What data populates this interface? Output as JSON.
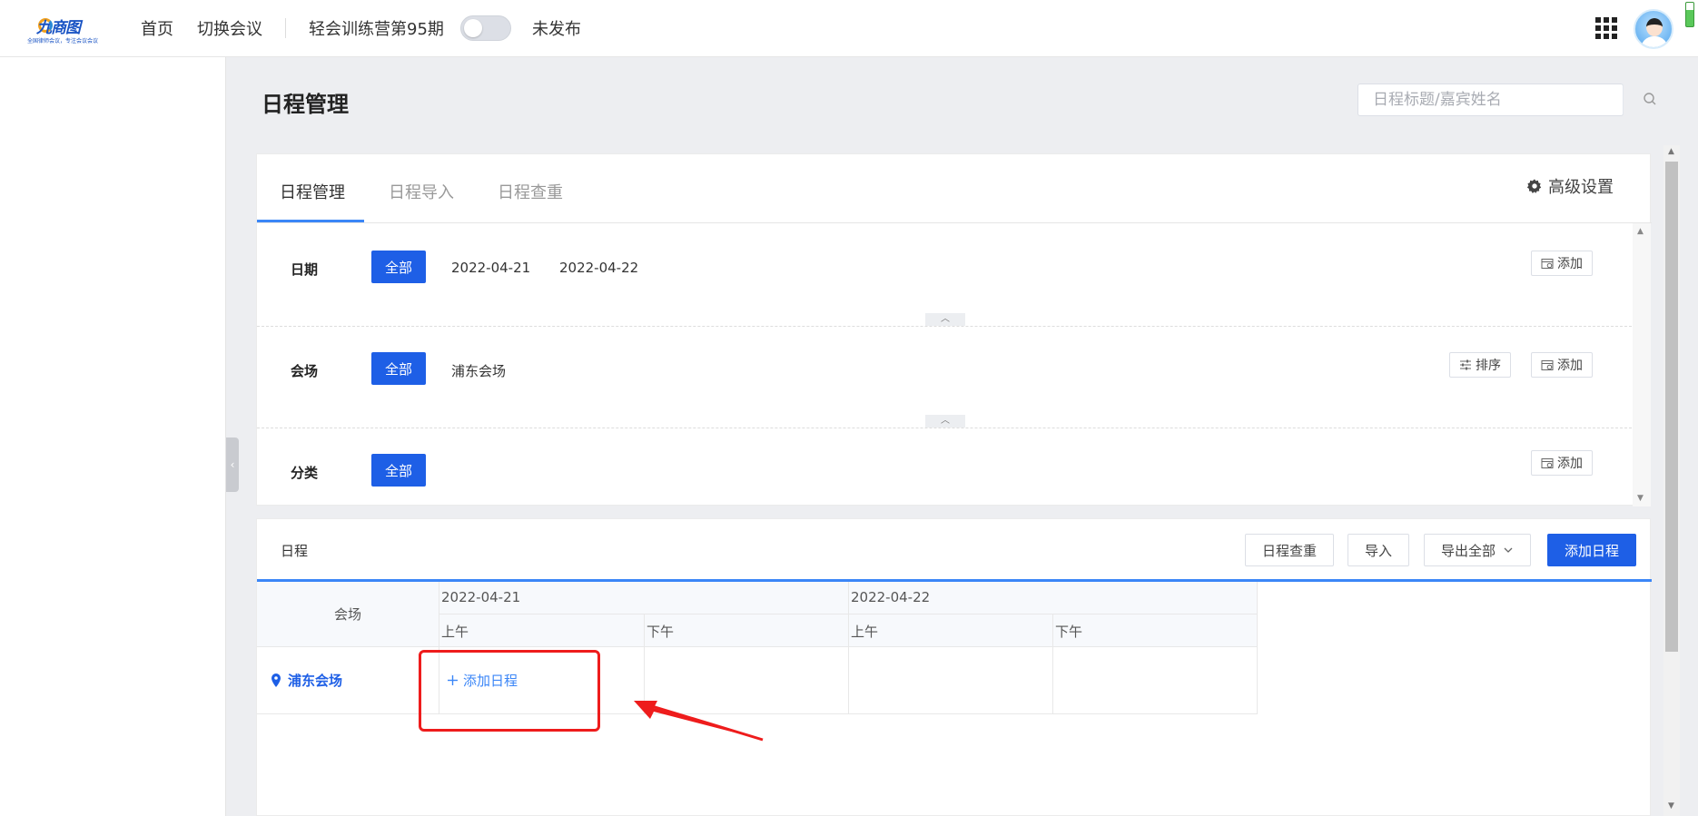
{
  "header": {
    "logo_text": "九商图",
    "logo_tagline": "全国律师会议，专注会议会议",
    "nav_home": "首页",
    "nav_switch": "切换会议",
    "meeting_title": "轻会训练营第95期",
    "publish_status": "未发布"
  },
  "page": {
    "title": "日程管理",
    "search_placeholder": "日程标题/嘉宾姓名"
  },
  "tabs": {
    "items": [
      "日程管理",
      "日程导入",
      "日程查重"
    ],
    "active": "日程管理",
    "advanced_settings": "高级设置"
  },
  "filters": {
    "date": {
      "label": "日期",
      "all": "全部",
      "options": [
        "2022-04-21",
        "2022-04-22"
      ],
      "add": "添加"
    },
    "venue": {
      "label": "会场",
      "all": "全部",
      "options": [
        "浦东会场"
      ],
      "sort": "排序",
      "add": "添加"
    },
    "category": {
      "label": "分类",
      "all": "全部",
      "add": "添加"
    }
  },
  "schedule": {
    "title": "日程",
    "buttons": {
      "check": "日程查重",
      "import": "导入",
      "export": "导出全部",
      "add": "添加日程"
    },
    "table": {
      "venue_header": "会场",
      "days": [
        {
          "date": "2022-04-21",
          "am": "上午",
          "pm": "下午"
        },
        {
          "date": "2022-04-22",
          "am": "上午",
          "pm": "下午"
        }
      ],
      "venue_row": "浦东会场",
      "add_link": "添加日程"
    }
  },
  "colors": {
    "primary": "#1e5fe6",
    "accent": "#3b86f7",
    "annotation": "#ee1c1c"
  }
}
